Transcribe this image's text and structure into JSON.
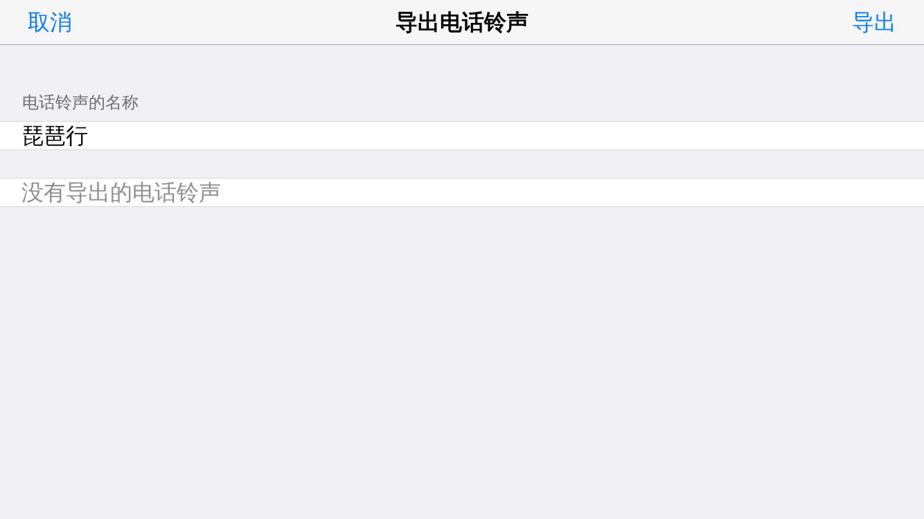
{
  "nav_bar": {
    "left_button": "取消",
    "title": "导出电话铃声",
    "right_button": "导出"
  },
  "name_section": {
    "header": "电话铃声的名称",
    "field": {
      "value": "琵琶行"
    }
  },
  "exported_section": {
    "empty_message": "没有导出的电话铃声"
  }
}
